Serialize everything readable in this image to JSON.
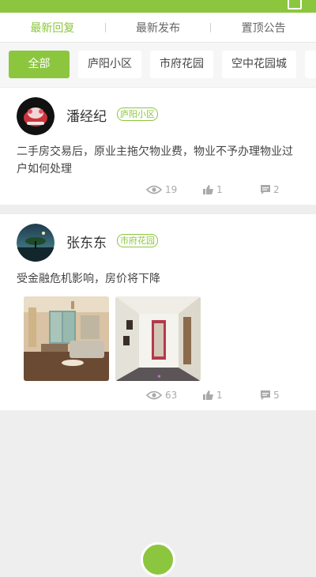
{
  "header": {
    "title": ""
  },
  "tabs": [
    {
      "label": "最新回复",
      "active": true
    },
    {
      "label": "最新发布"
    },
    {
      "label": "置顶公告"
    }
  ],
  "filters": [
    {
      "label": "全部",
      "active": true
    },
    {
      "label": "庐阳小区"
    },
    {
      "label": "市府花园"
    },
    {
      "label": "空中花园城"
    },
    {
      "label": ""
    }
  ],
  "posts": [
    {
      "author": "潘经纪",
      "tag": "庐阳小区",
      "content": "二手房交易后，原业主拖欠物业费，物业不予办理物业过户如何处理",
      "views": "19",
      "likes": "1",
      "comments": "2"
    },
    {
      "author": "张东东",
      "tag": "市府花园",
      "content": "受金融危机影响，房价将下降",
      "views": "63",
      "likes": "1",
      "comments": "5"
    }
  ],
  "colors": {
    "accent": "#8cc63f",
    "background": "#eeeeee"
  }
}
